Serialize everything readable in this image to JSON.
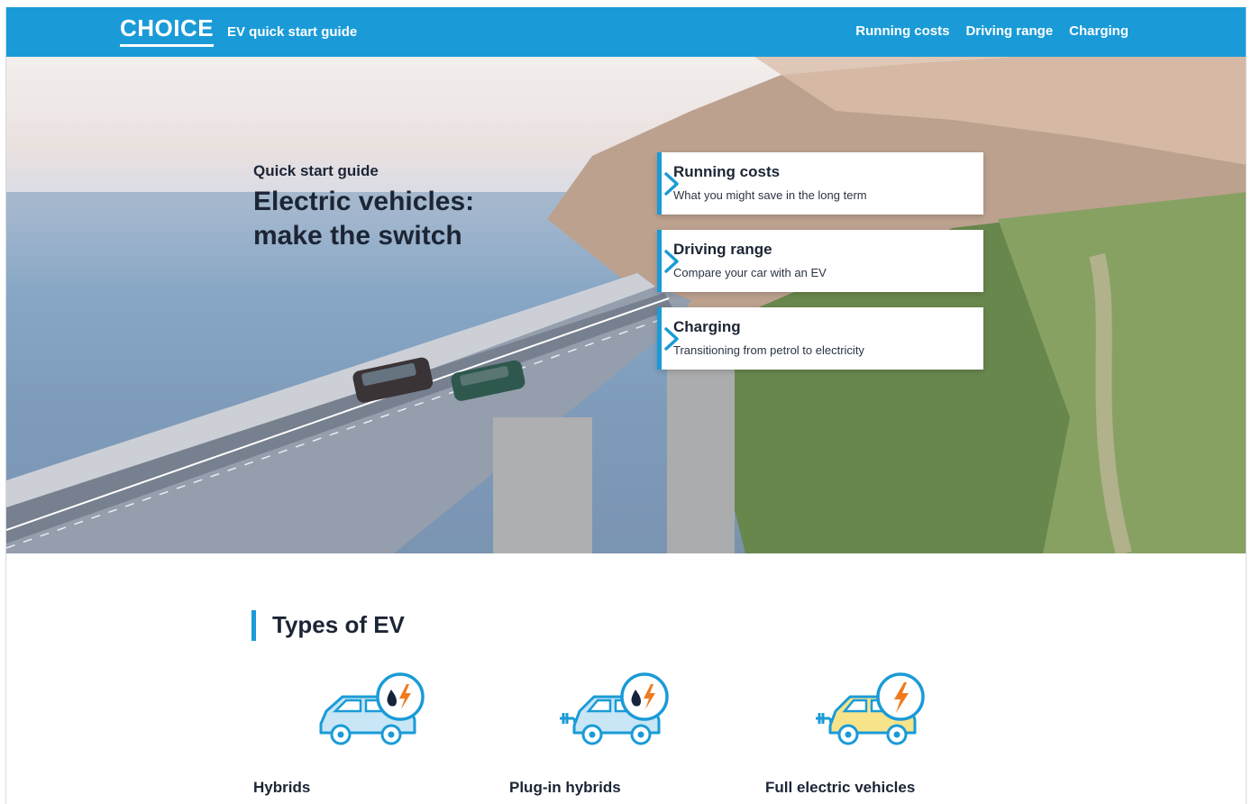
{
  "header": {
    "logo": "CHOICE",
    "app_title": "EV quick start guide",
    "nav": [
      "Running costs",
      "Driving range",
      "Charging"
    ]
  },
  "hero": {
    "eyebrow": "Quick start guide",
    "headline_line1": "Electric vehicles:",
    "headline_line2": "make the switch"
  },
  "cards": [
    {
      "title": "Running costs",
      "subtitle": "What you might save in the long term"
    },
    {
      "title": "Driving range",
      "subtitle": "Compare your car with an EV"
    },
    {
      "title": "Charging",
      "subtitle": "Transitioning from petrol to electricity"
    }
  ],
  "section": {
    "title": "Types of EV",
    "types": [
      "Hybrids",
      "Plug-in hybrids",
      "Full electric vehicles"
    ]
  },
  "colors": {
    "accent": "#1a9bd7",
    "heading": "#1c2535",
    "bolt": "#f07b1f"
  }
}
